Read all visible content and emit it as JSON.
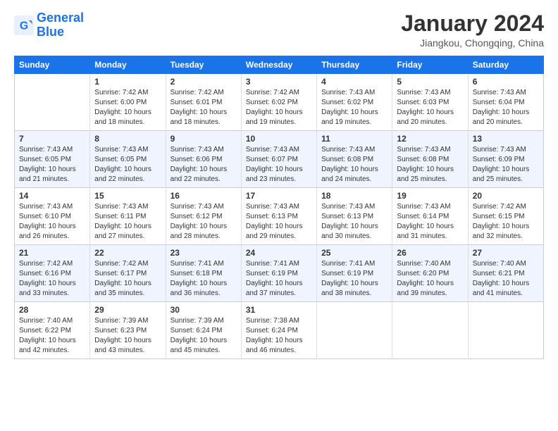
{
  "logo": {
    "line1": "General",
    "line2": "Blue"
  },
  "title": "January 2024",
  "location": "Jiangkou, Chongqing, China",
  "headers": [
    "Sunday",
    "Monday",
    "Tuesday",
    "Wednesday",
    "Thursday",
    "Friday",
    "Saturday"
  ],
  "weeks": [
    [
      {
        "day": "",
        "sunrise": "",
        "sunset": "",
        "daylight": ""
      },
      {
        "day": "1",
        "sunrise": "Sunrise: 7:42 AM",
        "sunset": "Sunset: 6:00 PM",
        "daylight": "Daylight: 10 hours and 18 minutes."
      },
      {
        "day": "2",
        "sunrise": "Sunrise: 7:42 AM",
        "sunset": "Sunset: 6:01 PM",
        "daylight": "Daylight: 10 hours and 18 minutes."
      },
      {
        "day": "3",
        "sunrise": "Sunrise: 7:42 AM",
        "sunset": "Sunset: 6:02 PM",
        "daylight": "Daylight: 10 hours and 19 minutes."
      },
      {
        "day": "4",
        "sunrise": "Sunrise: 7:43 AM",
        "sunset": "Sunset: 6:02 PM",
        "daylight": "Daylight: 10 hours and 19 minutes."
      },
      {
        "day": "5",
        "sunrise": "Sunrise: 7:43 AM",
        "sunset": "Sunset: 6:03 PM",
        "daylight": "Daylight: 10 hours and 20 minutes."
      },
      {
        "day": "6",
        "sunrise": "Sunrise: 7:43 AM",
        "sunset": "Sunset: 6:04 PM",
        "daylight": "Daylight: 10 hours and 20 minutes."
      }
    ],
    [
      {
        "day": "7",
        "sunrise": "Sunrise: 7:43 AM",
        "sunset": "Sunset: 6:05 PM",
        "daylight": "Daylight: 10 hours and 21 minutes."
      },
      {
        "day": "8",
        "sunrise": "Sunrise: 7:43 AM",
        "sunset": "Sunset: 6:05 PM",
        "daylight": "Daylight: 10 hours and 22 minutes."
      },
      {
        "day": "9",
        "sunrise": "Sunrise: 7:43 AM",
        "sunset": "Sunset: 6:06 PM",
        "daylight": "Daylight: 10 hours and 22 minutes."
      },
      {
        "day": "10",
        "sunrise": "Sunrise: 7:43 AM",
        "sunset": "Sunset: 6:07 PM",
        "daylight": "Daylight: 10 hours and 23 minutes."
      },
      {
        "day": "11",
        "sunrise": "Sunrise: 7:43 AM",
        "sunset": "Sunset: 6:08 PM",
        "daylight": "Daylight: 10 hours and 24 minutes."
      },
      {
        "day": "12",
        "sunrise": "Sunrise: 7:43 AM",
        "sunset": "Sunset: 6:08 PM",
        "daylight": "Daylight: 10 hours and 25 minutes."
      },
      {
        "day": "13",
        "sunrise": "Sunrise: 7:43 AM",
        "sunset": "Sunset: 6:09 PM",
        "daylight": "Daylight: 10 hours and 25 minutes."
      }
    ],
    [
      {
        "day": "14",
        "sunrise": "Sunrise: 7:43 AM",
        "sunset": "Sunset: 6:10 PM",
        "daylight": "Daylight: 10 hours and 26 minutes."
      },
      {
        "day": "15",
        "sunrise": "Sunrise: 7:43 AM",
        "sunset": "Sunset: 6:11 PM",
        "daylight": "Daylight: 10 hours and 27 minutes."
      },
      {
        "day": "16",
        "sunrise": "Sunrise: 7:43 AM",
        "sunset": "Sunset: 6:12 PM",
        "daylight": "Daylight: 10 hours and 28 minutes."
      },
      {
        "day": "17",
        "sunrise": "Sunrise: 7:43 AM",
        "sunset": "Sunset: 6:13 PM",
        "daylight": "Daylight: 10 hours and 29 minutes."
      },
      {
        "day": "18",
        "sunrise": "Sunrise: 7:43 AM",
        "sunset": "Sunset: 6:13 PM",
        "daylight": "Daylight: 10 hours and 30 minutes."
      },
      {
        "day": "19",
        "sunrise": "Sunrise: 7:43 AM",
        "sunset": "Sunset: 6:14 PM",
        "daylight": "Daylight: 10 hours and 31 minutes."
      },
      {
        "day": "20",
        "sunrise": "Sunrise: 7:42 AM",
        "sunset": "Sunset: 6:15 PM",
        "daylight": "Daylight: 10 hours and 32 minutes."
      }
    ],
    [
      {
        "day": "21",
        "sunrise": "Sunrise: 7:42 AM",
        "sunset": "Sunset: 6:16 PM",
        "daylight": "Daylight: 10 hours and 33 minutes."
      },
      {
        "day": "22",
        "sunrise": "Sunrise: 7:42 AM",
        "sunset": "Sunset: 6:17 PM",
        "daylight": "Daylight: 10 hours and 35 minutes."
      },
      {
        "day": "23",
        "sunrise": "Sunrise: 7:41 AM",
        "sunset": "Sunset: 6:18 PM",
        "daylight": "Daylight: 10 hours and 36 minutes."
      },
      {
        "day": "24",
        "sunrise": "Sunrise: 7:41 AM",
        "sunset": "Sunset: 6:19 PM",
        "daylight": "Daylight: 10 hours and 37 minutes."
      },
      {
        "day": "25",
        "sunrise": "Sunrise: 7:41 AM",
        "sunset": "Sunset: 6:19 PM",
        "daylight": "Daylight: 10 hours and 38 minutes."
      },
      {
        "day": "26",
        "sunrise": "Sunrise: 7:40 AM",
        "sunset": "Sunset: 6:20 PM",
        "daylight": "Daylight: 10 hours and 39 minutes."
      },
      {
        "day": "27",
        "sunrise": "Sunrise: 7:40 AM",
        "sunset": "Sunset: 6:21 PM",
        "daylight": "Daylight: 10 hours and 41 minutes."
      }
    ],
    [
      {
        "day": "28",
        "sunrise": "Sunrise: 7:40 AM",
        "sunset": "Sunset: 6:22 PM",
        "daylight": "Daylight: 10 hours and 42 minutes."
      },
      {
        "day": "29",
        "sunrise": "Sunrise: 7:39 AM",
        "sunset": "Sunset: 6:23 PM",
        "daylight": "Daylight: 10 hours and 43 minutes."
      },
      {
        "day": "30",
        "sunrise": "Sunrise: 7:39 AM",
        "sunset": "Sunset: 6:24 PM",
        "daylight": "Daylight: 10 hours and 45 minutes."
      },
      {
        "day": "31",
        "sunrise": "Sunrise: 7:38 AM",
        "sunset": "Sunset: 6:24 PM",
        "daylight": "Daylight: 10 hours and 46 minutes."
      },
      {
        "day": "",
        "sunrise": "",
        "sunset": "",
        "daylight": ""
      },
      {
        "day": "",
        "sunrise": "",
        "sunset": "",
        "daylight": ""
      },
      {
        "day": "",
        "sunrise": "",
        "sunset": "",
        "daylight": ""
      }
    ]
  ]
}
